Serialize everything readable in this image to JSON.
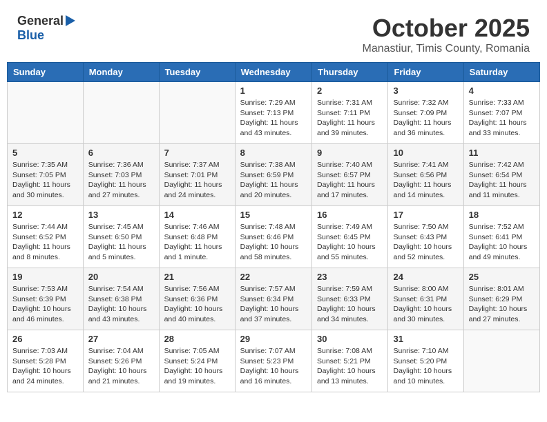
{
  "logo": {
    "general": "General",
    "blue": "Blue"
  },
  "title": "October 2025",
  "subtitle": "Manastiur, Timis County, Romania",
  "days_of_week": [
    "Sunday",
    "Monday",
    "Tuesday",
    "Wednesday",
    "Thursday",
    "Friday",
    "Saturday"
  ],
  "weeks": [
    [
      {
        "day": "",
        "info": ""
      },
      {
        "day": "",
        "info": ""
      },
      {
        "day": "",
        "info": ""
      },
      {
        "day": "1",
        "info": "Sunrise: 7:29 AM\nSunset: 7:13 PM\nDaylight: 11 hours and 43 minutes."
      },
      {
        "day": "2",
        "info": "Sunrise: 7:31 AM\nSunset: 7:11 PM\nDaylight: 11 hours and 39 minutes."
      },
      {
        "day": "3",
        "info": "Sunrise: 7:32 AM\nSunset: 7:09 PM\nDaylight: 11 hours and 36 minutes."
      },
      {
        "day": "4",
        "info": "Sunrise: 7:33 AM\nSunset: 7:07 PM\nDaylight: 11 hours and 33 minutes."
      }
    ],
    [
      {
        "day": "5",
        "info": "Sunrise: 7:35 AM\nSunset: 7:05 PM\nDaylight: 11 hours and 30 minutes."
      },
      {
        "day": "6",
        "info": "Sunrise: 7:36 AM\nSunset: 7:03 PM\nDaylight: 11 hours and 27 minutes."
      },
      {
        "day": "7",
        "info": "Sunrise: 7:37 AM\nSunset: 7:01 PM\nDaylight: 11 hours and 24 minutes."
      },
      {
        "day": "8",
        "info": "Sunrise: 7:38 AM\nSunset: 6:59 PM\nDaylight: 11 hours and 20 minutes."
      },
      {
        "day": "9",
        "info": "Sunrise: 7:40 AM\nSunset: 6:57 PM\nDaylight: 11 hours and 17 minutes."
      },
      {
        "day": "10",
        "info": "Sunrise: 7:41 AM\nSunset: 6:56 PM\nDaylight: 11 hours and 14 minutes."
      },
      {
        "day": "11",
        "info": "Sunrise: 7:42 AM\nSunset: 6:54 PM\nDaylight: 11 hours and 11 minutes."
      }
    ],
    [
      {
        "day": "12",
        "info": "Sunrise: 7:44 AM\nSunset: 6:52 PM\nDaylight: 11 hours and 8 minutes."
      },
      {
        "day": "13",
        "info": "Sunrise: 7:45 AM\nSunset: 6:50 PM\nDaylight: 11 hours and 5 minutes."
      },
      {
        "day": "14",
        "info": "Sunrise: 7:46 AM\nSunset: 6:48 PM\nDaylight: 11 hours and 1 minute."
      },
      {
        "day": "15",
        "info": "Sunrise: 7:48 AM\nSunset: 6:46 PM\nDaylight: 10 hours and 58 minutes."
      },
      {
        "day": "16",
        "info": "Sunrise: 7:49 AM\nSunset: 6:45 PM\nDaylight: 10 hours and 55 minutes."
      },
      {
        "day": "17",
        "info": "Sunrise: 7:50 AM\nSunset: 6:43 PM\nDaylight: 10 hours and 52 minutes."
      },
      {
        "day": "18",
        "info": "Sunrise: 7:52 AM\nSunset: 6:41 PM\nDaylight: 10 hours and 49 minutes."
      }
    ],
    [
      {
        "day": "19",
        "info": "Sunrise: 7:53 AM\nSunset: 6:39 PM\nDaylight: 10 hours and 46 minutes."
      },
      {
        "day": "20",
        "info": "Sunrise: 7:54 AM\nSunset: 6:38 PM\nDaylight: 10 hours and 43 minutes."
      },
      {
        "day": "21",
        "info": "Sunrise: 7:56 AM\nSunset: 6:36 PM\nDaylight: 10 hours and 40 minutes."
      },
      {
        "day": "22",
        "info": "Sunrise: 7:57 AM\nSunset: 6:34 PM\nDaylight: 10 hours and 37 minutes."
      },
      {
        "day": "23",
        "info": "Sunrise: 7:59 AM\nSunset: 6:33 PM\nDaylight: 10 hours and 34 minutes."
      },
      {
        "day": "24",
        "info": "Sunrise: 8:00 AM\nSunset: 6:31 PM\nDaylight: 10 hours and 30 minutes."
      },
      {
        "day": "25",
        "info": "Sunrise: 8:01 AM\nSunset: 6:29 PM\nDaylight: 10 hours and 27 minutes."
      }
    ],
    [
      {
        "day": "26",
        "info": "Sunrise: 7:03 AM\nSunset: 5:28 PM\nDaylight: 10 hours and 24 minutes."
      },
      {
        "day": "27",
        "info": "Sunrise: 7:04 AM\nSunset: 5:26 PM\nDaylight: 10 hours and 21 minutes."
      },
      {
        "day": "28",
        "info": "Sunrise: 7:05 AM\nSunset: 5:24 PM\nDaylight: 10 hours and 19 minutes."
      },
      {
        "day": "29",
        "info": "Sunrise: 7:07 AM\nSunset: 5:23 PM\nDaylight: 10 hours and 16 minutes."
      },
      {
        "day": "30",
        "info": "Sunrise: 7:08 AM\nSunset: 5:21 PM\nDaylight: 10 hours and 13 minutes."
      },
      {
        "day": "31",
        "info": "Sunrise: 7:10 AM\nSunset: 5:20 PM\nDaylight: 10 hours and 10 minutes."
      },
      {
        "day": "",
        "info": ""
      }
    ]
  ]
}
